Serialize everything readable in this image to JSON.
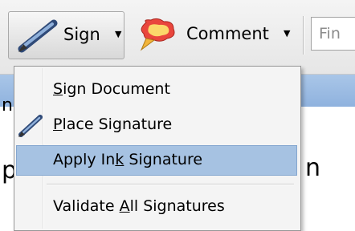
{
  "toolbar": {
    "sign_label": "Sign",
    "sign_caret": "▼",
    "comment_label": "Comment",
    "comment_caret": "▼",
    "find_placeholder": "Fin"
  },
  "background": {
    "left_fragment_1": "n",
    "left_fragment_2": "p",
    "right_fragment": "n"
  },
  "menu": {
    "items": [
      {
        "pre": "",
        "u": "S",
        "post": "ign Document",
        "icon": null,
        "highlighted": false
      },
      {
        "pre": "",
        "u": "P",
        "post": "lace Signature",
        "icon": "pen-icon",
        "highlighted": false
      },
      {
        "pre": "Apply In",
        "u": "k",
        "post": " Signature",
        "icon": null,
        "highlighted": true
      },
      {
        "pre": "Validate ",
        "u": "A",
        "post": "ll Signatures",
        "icon": null,
        "highlighted": false
      }
    ]
  },
  "colors": {
    "highlight": "#a6c2e2",
    "menu_bg": "#f4f4f4",
    "strip": "#9bbbe2"
  }
}
